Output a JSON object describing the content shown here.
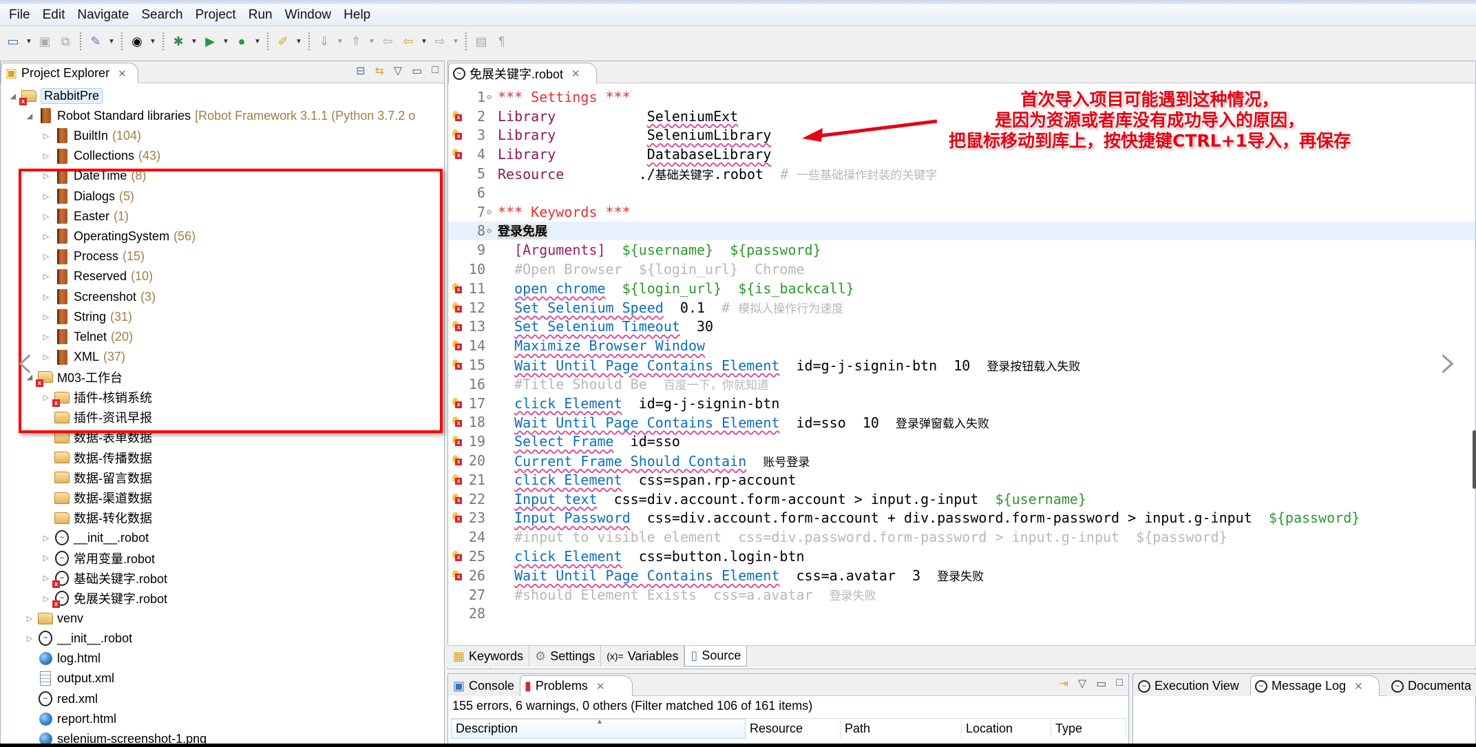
{
  "menu": [
    "File",
    "Edit",
    "Navigate",
    "Search",
    "Project",
    "Run",
    "Window",
    "Help"
  ],
  "toolbar": {
    "icons": [
      "new-icon",
      "save-icon",
      "save-all-icon",
      "refactor-icon",
      "perspective-icon",
      "debug-icon",
      "run-icon",
      "external-tools-icon",
      "marker-icon",
      "next-annotation-icon",
      "prev-annotation-icon",
      "last-edit-icon",
      "back-icon",
      "forward-icon",
      "block-select-icon",
      "show-whitespace-icon"
    ]
  },
  "explorer": {
    "tab_label": "Project Explorer",
    "project": "RabbitPre",
    "stdlib": {
      "label": "Robot Standard libraries",
      "detail": "[Robot Framework 3.1.1 (Python 3.7.2 o",
      "libraries": [
        {
          "name": "BuiltIn",
          "count": "(104)"
        },
        {
          "name": "Collections",
          "count": "(43)"
        },
        {
          "name": "DateTime",
          "count": "(8)"
        },
        {
          "name": "Dialogs",
          "count": "(5)"
        },
        {
          "name": "Easter",
          "count": "(1)"
        },
        {
          "name": "OperatingSystem",
          "count": "(56)"
        },
        {
          "name": "Process",
          "count": "(15)"
        },
        {
          "name": "Reserved",
          "count": "(10)"
        },
        {
          "name": "Screenshot",
          "count": "(3)"
        },
        {
          "name": "String",
          "count": "(31)"
        },
        {
          "name": "Telnet",
          "count": "(20)"
        },
        {
          "name": "XML",
          "count": "(37)"
        }
      ]
    },
    "folder_m03": "M03-工作台",
    "m03_children": [
      {
        "name": "插件-核销系统",
        "type": "folder",
        "error": true,
        "expandable": true
      },
      {
        "name": "插件-资讯早报",
        "type": "folder",
        "error": false,
        "expandable": false
      },
      {
        "name": "数据-表单数据",
        "type": "folder",
        "error": false,
        "expandable": false
      },
      {
        "name": "数据-传播数据",
        "type": "folder",
        "error": false,
        "expandable": false
      },
      {
        "name": "数据-留言数据",
        "type": "folder",
        "error": false,
        "expandable": false
      },
      {
        "name": "数据-渠道数据",
        "type": "folder",
        "error": false,
        "expandable": false
      },
      {
        "name": "数据-转化数据",
        "type": "folder",
        "error": false,
        "expandable": false
      },
      {
        "name": "__init__.robot",
        "type": "robot",
        "error": false,
        "expandable": true
      },
      {
        "name": "常用变量.robot",
        "type": "robot",
        "error": false,
        "expandable": true
      },
      {
        "name": "基础关键字.robot",
        "type": "robot",
        "error": true,
        "expandable": true
      },
      {
        "name": "免展关键字.robot",
        "type": "robot",
        "error": true,
        "expandable": true
      }
    ],
    "root_items": [
      {
        "name": "venv",
        "type": "folder",
        "expandable": true
      },
      {
        "name": "__init__.robot",
        "type": "robot",
        "expandable": true
      },
      {
        "name": "log.html",
        "type": "html",
        "expandable": false
      },
      {
        "name": "output.xml",
        "type": "xml",
        "expandable": false
      },
      {
        "name": "red.xml",
        "type": "robot",
        "expandable": false
      },
      {
        "name": "report.html",
        "type": "html",
        "expandable": false
      },
      {
        "name": "selenium-screenshot-1.png",
        "type": "html",
        "expandable": false
      }
    ]
  },
  "editor": {
    "tab_label": "免展关键字.robot",
    "lines": [
      {
        "n": "1",
        "fold": true,
        "mark": false,
        "parts": [
          [
            "sec",
            "*** Settings ***"
          ]
        ]
      },
      {
        "n": "2",
        "fold": false,
        "mark": true,
        "parts": [
          [
            "setk",
            "Library"
          ],
          [
            "pad",
            "           "
          ],
          [
            "plainkw",
            "SeleniumExt"
          ]
        ]
      },
      {
        "n": "3",
        "fold": false,
        "mark": true,
        "parts": [
          [
            "setk",
            "Library"
          ],
          [
            "pad",
            "           "
          ],
          [
            "plainkw",
            "SeleniumLibrary"
          ]
        ]
      },
      {
        "n": "4",
        "fold": false,
        "mark": true,
        "parts": [
          [
            "setk",
            "Library"
          ],
          [
            "pad",
            "           "
          ],
          [
            "plainkw",
            "DatabaseLibrary"
          ]
        ]
      },
      {
        "n": "5",
        "fold": false,
        "mark": false,
        "parts": [
          [
            "setk",
            "Resource"
          ],
          [
            "pad",
            "         "
          ],
          [
            "plain",
            "./"
          ],
          [
            "cjk",
            "基础关键字"
          ],
          [
            "plain",
            ".robot"
          ],
          [
            "pad",
            "  "
          ],
          [
            "cm",
            "# "
          ],
          [
            "cmcjk",
            "一些基础操作封装的关键字"
          ]
        ]
      },
      {
        "n": "6",
        "fold": false,
        "mark": false,
        "parts": []
      },
      {
        "n": "7",
        "fold": true,
        "mark": false,
        "parts": [
          [
            "sec",
            "*** Keywords ***"
          ]
        ]
      },
      {
        "n": "8",
        "fold": true,
        "mark": false,
        "current": true,
        "parts": [
          [
            "kwname",
            "登录免展"
          ]
        ]
      },
      {
        "n": "9",
        "fold": false,
        "mark": false,
        "parts": [
          [
            "pad",
            "  "
          ],
          [
            "arg",
            "[Arguments]"
          ],
          [
            "pad",
            "  "
          ],
          [
            "var",
            "${username}"
          ],
          [
            "pad",
            "  "
          ],
          [
            "var",
            "${password}"
          ]
        ]
      },
      {
        "n": "10",
        "fold": false,
        "mark": false,
        "parts": [
          [
            "pad",
            "  "
          ],
          [
            "cm",
            "#Open Browser  ${login_url}  Chrome"
          ]
        ]
      },
      {
        "n": "11",
        "fold": false,
        "mark": true,
        "parts": [
          [
            "pad",
            "  "
          ],
          [
            "kw",
            "open chrome"
          ],
          [
            "pad",
            "  "
          ],
          [
            "var",
            "${login_url}"
          ],
          [
            "pad",
            "  "
          ],
          [
            "var",
            "${is_backcall}"
          ]
        ]
      },
      {
        "n": "12",
        "fold": false,
        "mark": true,
        "parts": [
          [
            "pad",
            "  "
          ],
          [
            "kw",
            "Set Selenium Speed"
          ],
          [
            "plain",
            "  0.1  "
          ],
          [
            "cm",
            "# "
          ],
          [
            "cmcjk",
            "模拟人操作行为速度"
          ]
        ]
      },
      {
        "n": "13",
        "fold": false,
        "mark": true,
        "parts": [
          [
            "pad",
            "  "
          ],
          [
            "kw",
            "Set Selenium Timeout"
          ],
          [
            "plain",
            "  30"
          ]
        ]
      },
      {
        "n": "14",
        "fold": false,
        "mark": true,
        "parts": [
          [
            "pad",
            "  "
          ],
          [
            "kw",
            "Maximize Browser Window"
          ]
        ]
      },
      {
        "n": "15",
        "fold": false,
        "mark": true,
        "parts": [
          [
            "pad",
            "  "
          ],
          [
            "kw",
            "Wait Until Page Contains Element"
          ],
          [
            "plain",
            "  id=g-j-signin-btn  10  "
          ],
          [
            "cjk",
            "登录按钮载入失败"
          ]
        ]
      },
      {
        "n": "16",
        "fold": false,
        "mark": false,
        "parts": [
          [
            "pad",
            "  "
          ],
          [
            "cm",
            "#Title Should Be  "
          ],
          [
            "cmcjk",
            "百度一下，你就知道"
          ]
        ]
      },
      {
        "n": "17",
        "fold": false,
        "mark": true,
        "parts": [
          [
            "pad",
            "  "
          ],
          [
            "kw",
            "click Element"
          ],
          [
            "plain",
            "  id=g-j-signin-btn"
          ]
        ]
      },
      {
        "n": "18",
        "fold": false,
        "mark": true,
        "parts": [
          [
            "pad",
            "  "
          ],
          [
            "kw",
            "Wait Until Page Contains Element"
          ],
          [
            "plain",
            "  id=sso  10  "
          ],
          [
            "cjk",
            "登录弹窗载入失败"
          ]
        ]
      },
      {
        "n": "19",
        "fold": false,
        "mark": true,
        "parts": [
          [
            "pad",
            "  "
          ],
          [
            "kw",
            "Select Frame"
          ],
          [
            "plain",
            "  id=sso"
          ]
        ]
      },
      {
        "n": "20",
        "fold": false,
        "mark": true,
        "parts": [
          [
            "pad",
            "  "
          ],
          [
            "kw",
            "Current Frame Should Contain"
          ],
          [
            "plain",
            "  "
          ],
          [
            "cjk",
            "账号登录"
          ]
        ]
      },
      {
        "n": "21",
        "fold": false,
        "mark": true,
        "parts": [
          [
            "pad",
            "  "
          ],
          [
            "kw",
            "click Element"
          ],
          [
            "plain",
            "  css=span.rp-account"
          ]
        ]
      },
      {
        "n": "22",
        "fold": false,
        "mark": true,
        "parts": [
          [
            "pad",
            "  "
          ],
          [
            "kw",
            "Input text"
          ],
          [
            "plain",
            "  css=div.account.form-account > input.g-input  "
          ],
          [
            "var",
            "${username}"
          ]
        ]
      },
      {
        "n": "23",
        "fold": false,
        "mark": true,
        "parts": [
          [
            "pad",
            "  "
          ],
          [
            "kw",
            "Input Password"
          ],
          [
            "plain",
            "  css=div.account.form-account + div.password.form-password > input.g-input  "
          ],
          [
            "var",
            "${password}"
          ]
        ]
      },
      {
        "n": "24",
        "fold": false,
        "mark": false,
        "parts": [
          [
            "pad",
            "  "
          ],
          [
            "cm",
            "#input to visible element  css=div.password.form-password > input.g-input  ${password}"
          ]
        ]
      },
      {
        "n": "25",
        "fold": false,
        "mark": true,
        "parts": [
          [
            "pad",
            "  "
          ],
          [
            "kw",
            "click Element"
          ],
          [
            "plain",
            "  css=button.login-btn"
          ]
        ]
      },
      {
        "n": "26",
        "fold": false,
        "mark": true,
        "parts": [
          [
            "pad",
            "  "
          ],
          [
            "kw",
            "Wait Until Page Contains Element"
          ],
          [
            "plain",
            "  css=a.avatar  3  "
          ],
          [
            "cjk",
            "登录失败"
          ]
        ]
      },
      {
        "n": "27",
        "fold": false,
        "mark": false,
        "parts": [
          [
            "pad",
            "  "
          ],
          [
            "cm",
            "#should Element Exists  css=a.avatar  "
          ],
          [
            "cmcjk",
            "登录失败"
          ]
        ]
      },
      {
        "n": "28",
        "fold": false,
        "mark": false,
        "parts": []
      }
    ],
    "annotation": [
      "首次导入项目可能遇到这种情况，",
      "是因为资源或者库没有成功导入的原因，",
      "把鼠标移动到库上，按快捷键CTRL+1导入，再保存"
    ],
    "page_tabs": [
      {
        "label": "Keywords",
        "icon": "keywords-icon"
      },
      {
        "label": "Settings",
        "icon": "gear-icon"
      },
      {
        "label": "Variables",
        "icon": "variables-icon"
      },
      {
        "label": "Source",
        "icon": "source-icon",
        "active": true
      }
    ],
    "variables_prefix": "(x)="
  },
  "problems": {
    "tabs": [
      {
        "label": "Console"
      },
      {
        "label": "Problems",
        "active": true
      }
    ],
    "summary": "155 errors, 6 warnings, 0 others (Filter matched 106 of 161 items)",
    "columns": [
      "Description",
      "Resource",
      "Path",
      "Location",
      "Type"
    ]
  },
  "log_panel": {
    "tabs": [
      {
        "label": "Execution View"
      },
      {
        "label": "Message Log",
        "active": true
      },
      {
        "label": "Documenta"
      }
    ]
  },
  "colors": {
    "annotation_red": "#e60012",
    "highlight_box": "#ff0000",
    "keyword_blue": "#0a6fc2",
    "variable_green": "#2a9a2a",
    "section_red": "#e53030"
  }
}
